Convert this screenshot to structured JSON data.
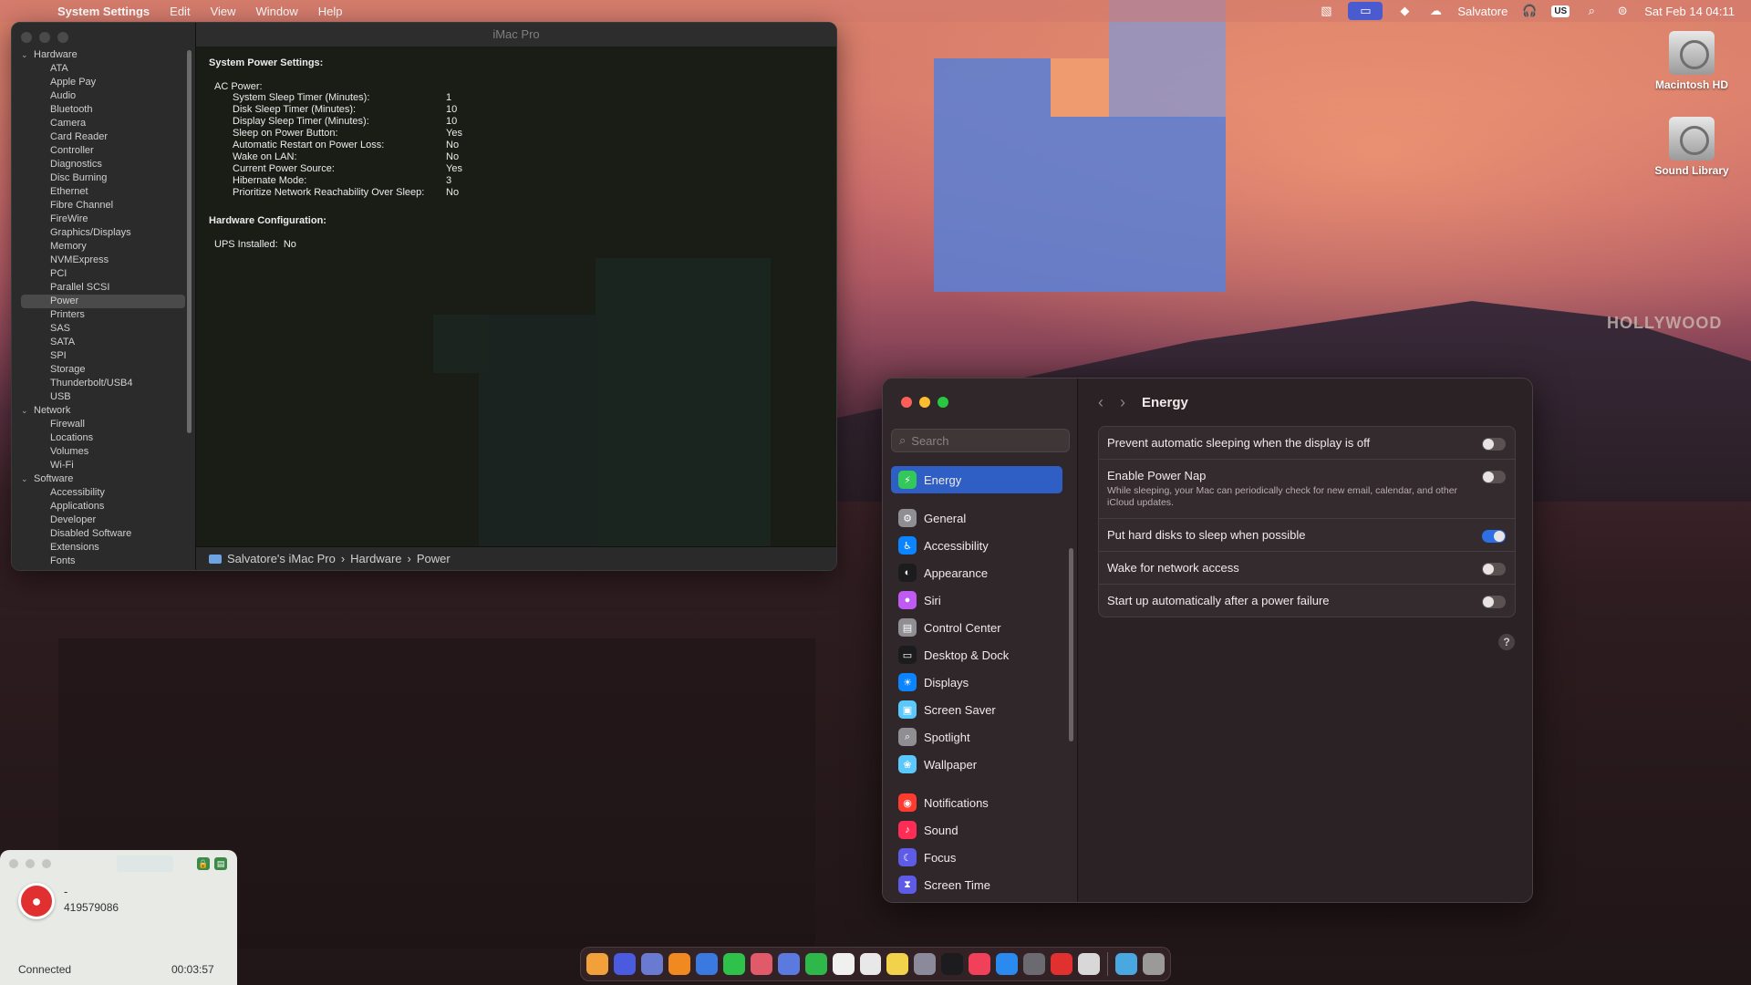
{
  "menubar": {
    "app_name": "System Settings",
    "menus": [
      "Edit",
      "View",
      "Window",
      "Help"
    ],
    "user": "Salvatore",
    "input_source": "US",
    "datetime": "Sat Feb 14  04:11"
  },
  "desktop": {
    "icons": [
      {
        "label": "Macintosh HD"
      },
      {
        "label": "Sound Library"
      }
    ]
  },
  "sysinfo": {
    "title": "iMac Pro",
    "tree": [
      {
        "type": "group",
        "label": "Hardware"
      },
      {
        "type": "item",
        "label": "ATA"
      },
      {
        "type": "item",
        "label": "Apple Pay"
      },
      {
        "type": "item",
        "label": "Audio"
      },
      {
        "type": "item",
        "label": "Bluetooth"
      },
      {
        "type": "item",
        "label": "Camera"
      },
      {
        "type": "item",
        "label": "Card Reader"
      },
      {
        "type": "item",
        "label": "Controller"
      },
      {
        "type": "item",
        "label": "Diagnostics"
      },
      {
        "type": "item",
        "label": "Disc Burning"
      },
      {
        "type": "item",
        "label": "Ethernet"
      },
      {
        "type": "item",
        "label": "Fibre Channel"
      },
      {
        "type": "item",
        "label": "FireWire"
      },
      {
        "type": "item",
        "label": "Graphics/Displays"
      },
      {
        "type": "item",
        "label": "Memory"
      },
      {
        "type": "item",
        "label": "NVMExpress"
      },
      {
        "type": "item",
        "label": "PCI"
      },
      {
        "type": "item",
        "label": "Parallel SCSI"
      },
      {
        "type": "item",
        "label": "Power",
        "selected": true
      },
      {
        "type": "item",
        "label": "Printers"
      },
      {
        "type": "item",
        "label": "SAS"
      },
      {
        "type": "item",
        "label": "SATA"
      },
      {
        "type": "item",
        "label": "SPI"
      },
      {
        "type": "item",
        "label": "Storage"
      },
      {
        "type": "item",
        "label": "Thunderbolt/USB4"
      },
      {
        "type": "item",
        "label": "USB"
      },
      {
        "type": "group",
        "label": "Network"
      },
      {
        "type": "item",
        "label": "Firewall"
      },
      {
        "type": "item",
        "label": "Locations"
      },
      {
        "type": "item",
        "label": "Volumes"
      },
      {
        "type": "item",
        "label": "Wi-Fi"
      },
      {
        "type": "group",
        "label": "Software"
      },
      {
        "type": "item",
        "label": "Accessibility"
      },
      {
        "type": "item",
        "label": "Applications"
      },
      {
        "type": "item",
        "label": "Developer"
      },
      {
        "type": "item",
        "label": "Disabled Software"
      },
      {
        "type": "item",
        "label": "Extensions"
      },
      {
        "type": "item",
        "label": "Fonts"
      }
    ],
    "content": {
      "heading": "System Power Settings:",
      "ac_label": "AC Power:",
      "ac_rows": [
        {
          "key": "System Sleep Timer (Minutes):",
          "value": "1"
        },
        {
          "key": "Disk Sleep Timer (Minutes):",
          "value": "10"
        },
        {
          "key": "Display Sleep Timer (Minutes):",
          "value": "10"
        },
        {
          "key": "Sleep on Power Button:",
          "value": "Yes"
        },
        {
          "key": "Automatic Restart on Power Loss:",
          "value": "No"
        },
        {
          "key": "Wake on LAN:",
          "value": "No"
        },
        {
          "key": "Current Power Source:",
          "value": "Yes"
        },
        {
          "key": "Hibernate Mode:",
          "value": "3"
        },
        {
          "key": "Prioritize Network Reachability Over Sleep:",
          "value": "No"
        }
      ],
      "hw_heading": "Hardware Configuration:",
      "ups_label": "UPS Installed:",
      "ups_value": "No"
    },
    "pathbar": [
      "Salvatore's iMac Pro",
      "Hardware",
      "Power"
    ]
  },
  "settings": {
    "search_placeholder": "Search",
    "page_title": "Energy",
    "nav": [
      {
        "label": "Energy",
        "icon": "bolt-icon",
        "color": "#34c759",
        "glyph": "⚡",
        "active": true,
        "gap_after": "big"
      },
      {
        "label": "General",
        "icon": "gear-icon",
        "color": "#8e8e93",
        "glyph": "⚙"
      },
      {
        "label": "Accessibility",
        "icon": "accessibility-icon",
        "color": "#0a84ff",
        "glyph": "♿"
      },
      {
        "label": "Appearance",
        "icon": "appearance-icon",
        "color": "#1c1c1e",
        "glyph": "◐"
      },
      {
        "label": "Siri",
        "icon": "siri-icon",
        "color": "#bf5af2",
        "glyph": "●"
      },
      {
        "label": "Control Center",
        "icon": "control-center-icon",
        "color": "#8e8e93",
        "glyph": "▤"
      },
      {
        "label": "Desktop & Dock",
        "icon": "desktop-dock-icon",
        "color": "#1c1c1e",
        "glyph": "▭"
      },
      {
        "label": "Displays",
        "icon": "displays-icon",
        "color": "#0a84ff",
        "glyph": "☀"
      },
      {
        "label": "Screen Saver",
        "icon": "screen-saver-icon",
        "color": "#5ac8fa",
        "glyph": "▣"
      },
      {
        "label": "Spotlight",
        "icon": "spotlight-icon",
        "color": "#8e8e93",
        "glyph": "⌕"
      },
      {
        "label": "Wallpaper",
        "icon": "wallpaper-icon",
        "color": "#5ac8fa",
        "glyph": "❀",
        "gap_after": "big"
      },
      {
        "label": "Notifications",
        "icon": "notifications-icon",
        "color": "#ff3b30",
        "glyph": "◉"
      },
      {
        "label": "Sound",
        "icon": "sound-icon",
        "color": "#ff2d55",
        "glyph": "♪"
      },
      {
        "label": "Focus",
        "icon": "focus-icon",
        "color": "#5e5ce6",
        "glyph": "☾"
      },
      {
        "label": "Screen Time",
        "icon": "screen-time-icon",
        "color": "#5e5ce6",
        "glyph": "⧗"
      }
    ],
    "options": [
      {
        "label": "Prevent automatic sleeping when the display is off",
        "on": false
      },
      {
        "label": "Enable Power Nap",
        "desc": "While sleeping, your Mac can periodically check for new email, calendar, and other iCloud updates.",
        "on": false
      },
      {
        "label": "Put hard disks to sleep when possible",
        "on": true
      },
      {
        "label": "Wake for network access",
        "on": false
      },
      {
        "label": "Start up automatically after a power failure",
        "on": false
      }
    ],
    "help": "?"
  },
  "call": {
    "name": "-",
    "number": "419579086",
    "status": "Connected",
    "timer": "00:03:57"
  },
  "dock": {
    "apps": [
      {
        "name": "finder-icon",
        "color": "#f2a13a"
      },
      {
        "name": "xcode-icon",
        "color": "#4a5be0"
      },
      {
        "name": "launchpad-icon",
        "color": "#6a7ad0"
      },
      {
        "name": "safari-icon",
        "color": "#f08a20"
      },
      {
        "name": "chrome-icon",
        "color": "#3a7ae0"
      },
      {
        "name": "messages-icon",
        "color": "#2fc24a"
      },
      {
        "name": "photos-icon",
        "color": "#e05a6a"
      },
      {
        "name": "photos-alt-icon",
        "color": "#5a7ae0"
      },
      {
        "name": "facetime-icon",
        "color": "#2fb84a"
      },
      {
        "name": "calendar-icon",
        "color": "#f0f0f0"
      },
      {
        "name": "reminders-icon",
        "color": "#e8e8e8"
      },
      {
        "name": "notes-icon",
        "color": "#f2d24a"
      },
      {
        "name": "system-info-icon",
        "color": "#8a8a9a"
      },
      {
        "name": "tv-icon",
        "color": "#1c1c1e"
      },
      {
        "name": "music-icon",
        "color": "#f0405a"
      },
      {
        "name": "app-store-icon",
        "color": "#2a8af0"
      },
      {
        "name": "system-settings-icon",
        "color": "#6a6a70"
      },
      {
        "name": "call-app-icon",
        "color": "#e03030"
      },
      {
        "name": "preview-icon",
        "color": "#d8d8d8"
      },
      {
        "name": "downloads-folder-icon",
        "color": "#4aa8e0"
      },
      {
        "name": "trash-icon",
        "color": "#9a9a9a"
      }
    ]
  }
}
